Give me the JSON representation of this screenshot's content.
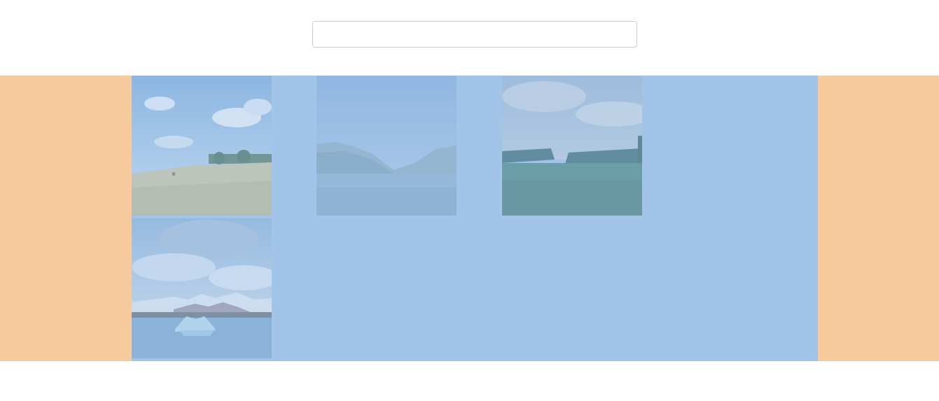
{
  "search": {
    "value": "",
    "placeholder": ""
  },
  "gallery": {
    "images": [
      {
        "subject": "wheat-field-landscape-image"
      },
      {
        "subject": "mountain-lake-landscape-image"
      },
      {
        "subject": "green-plain-cliffs-landscape-image"
      },
      {
        "subject": "glacier-lagoon-icebergs-image"
      }
    ]
  },
  "colors": {
    "highlight_band": "#f6ca9c",
    "content_area": "#a2c4e9",
    "page_background": "#ffffff"
  }
}
